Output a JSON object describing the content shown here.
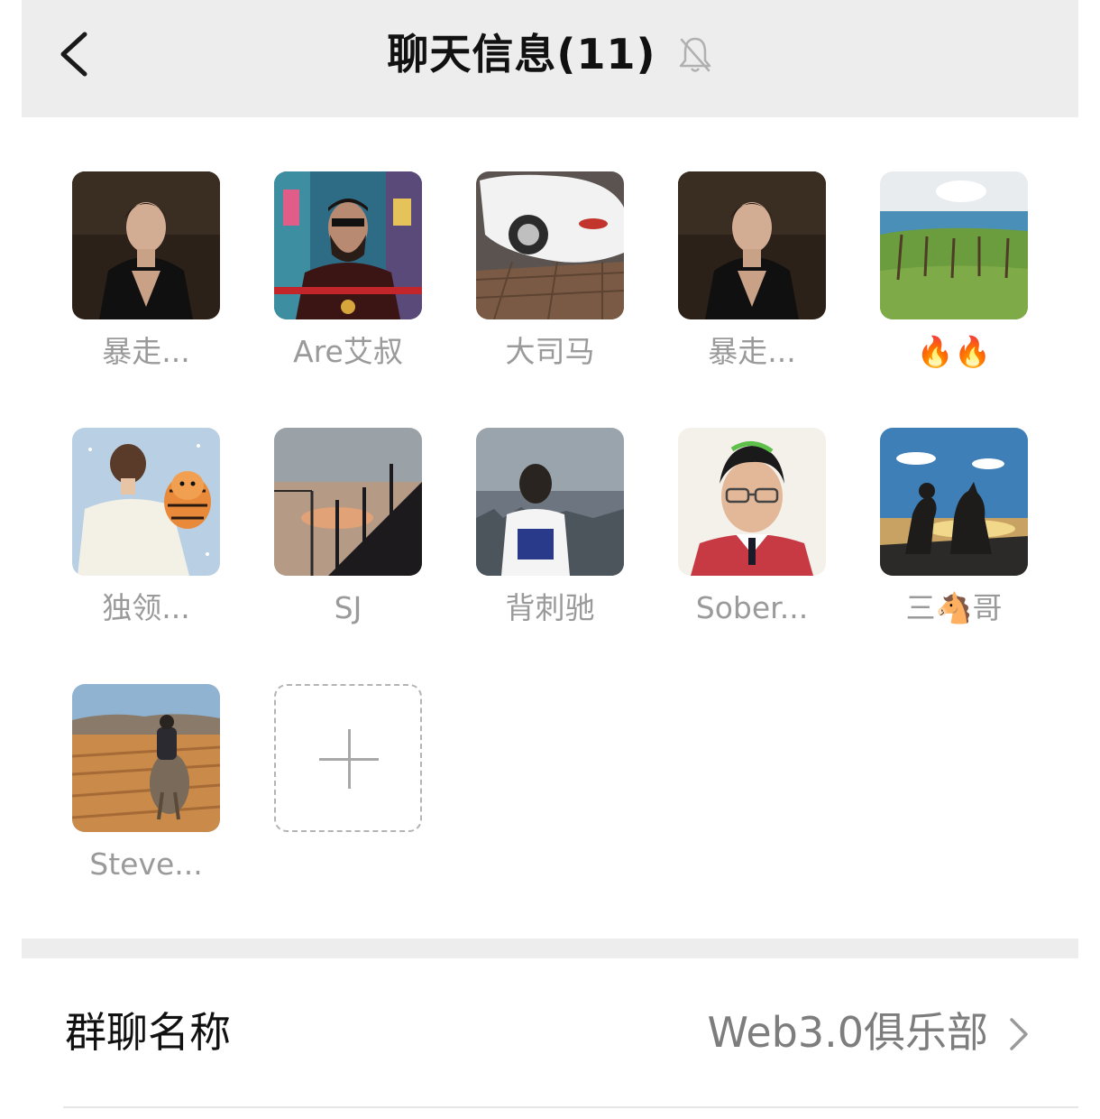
{
  "header": {
    "title": "聊天信息(11)",
    "back_icon": "chevron-left-icon",
    "mute_icon": "bell-off-icon"
  },
  "members": [
    {
      "name": "暴走..."
    },
    {
      "name": "Are艾叔"
    },
    {
      "name": "大司马"
    },
    {
      "name": "暴走..."
    },
    {
      "name": "🔥🔥"
    },
    {
      "name": "独领..."
    },
    {
      "name": "SJ"
    },
    {
      "name": "背刺驰"
    },
    {
      "name": "Sober..."
    },
    {
      "name": "三🐴哥"
    },
    {
      "name": "Steve..."
    }
  ],
  "add_member": {
    "icon": "plus-icon"
  },
  "settings": {
    "group_name_label": "群聊名称",
    "group_name_value": "Web3.0俱乐部",
    "chevron_icon": "chevron-right-icon"
  }
}
